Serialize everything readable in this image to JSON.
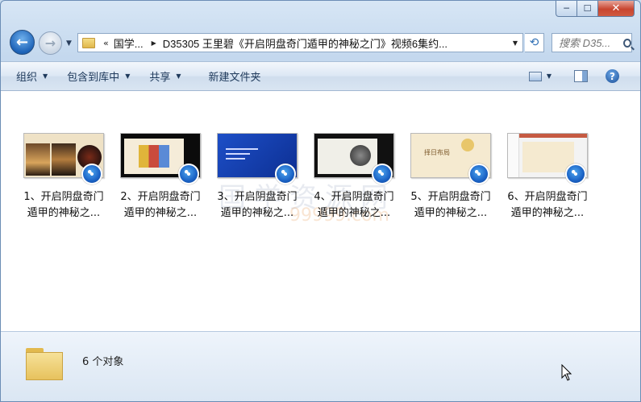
{
  "window": {
    "caption": {
      "minimize": "─",
      "maximize": "☐",
      "close": "✕"
    }
  },
  "address": {
    "segments": [
      "国学...",
      "D35305 王里碧《开启阴盘奇门遁甲的神秘之门》视频6集约..."
    ],
    "overflow": "«"
  },
  "search": {
    "placeholder": "搜索 D35..."
  },
  "toolbar": {
    "organize": "组织",
    "include_library": "包含到库中",
    "share": "共享",
    "new_folder": "新建文件夹"
  },
  "files": [
    {
      "label_line1": "1、开启阴盘奇门",
      "label_line2": "遁甲的神秘之..."
    },
    {
      "label_line1": "2、开启阴盘奇门",
      "label_line2": "遁甲的神秘之..."
    },
    {
      "label_line1": "3、开启阴盘奇门",
      "label_line2": "遁甲的神秘之..."
    },
    {
      "label_line1": "4、开启阴盘奇门",
      "label_line2": "遁甲的神秘之..."
    },
    {
      "label_line1": "5、开启阴盘奇门",
      "label_line2": "遁甲的神秘之..."
    },
    {
      "label_line1": "6、开启阴盘奇门",
      "label_line2": "遁甲的神秘之..."
    }
  ],
  "thumbnail_text": {
    "t5_title": "择日布局"
  },
  "watermark": {
    "line1": "国学资源网",
    "line2": "99999.com"
  },
  "details": {
    "count": "6 个对象"
  },
  "colors": {
    "accent": "#1d63b8",
    "close": "#c8452f"
  }
}
